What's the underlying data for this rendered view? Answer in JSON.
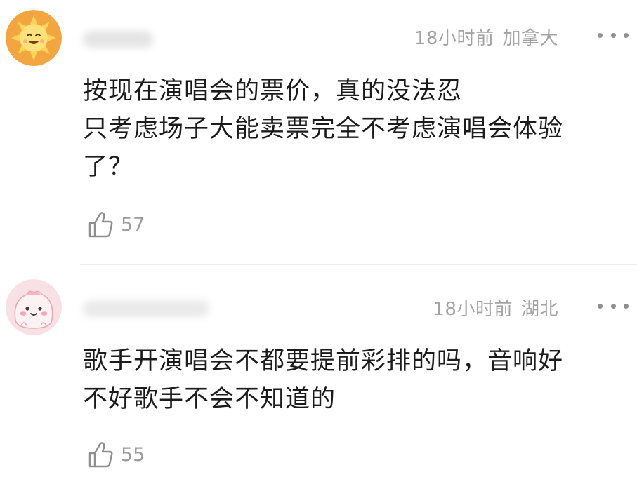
{
  "comments": [
    {
      "avatar_icon": "sun-face-icon",
      "time": "18小时前",
      "location": "加拿大",
      "lines": [
        "按现在演唱会的票价，真的没法忍",
        "只考虑场子大能卖票完全不考虑演唱会体验",
        "了？"
      ],
      "likes": "57"
    },
    {
      "avatar_icon": "pink-blob-face-icon",
      "time": "18小时前",
      "location": "湖北",
      "lines": [
        "歌手开演唱会不都要提前彩排的吗，音响好",
        "不好歌手不会不知道的"
      ],
      "likes": "55"
    }
  ],
  "colors": {
    "meta": "#a3a3a3",
    "text": "#1b1b1b",
    "divider": "#ededed"
  }
}
